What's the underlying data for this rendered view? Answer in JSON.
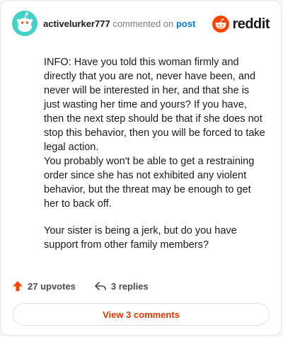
{
  "header": {
    "username": "activelurker777",
    "action_text": "commented on",
    "post_link": "post",
    "avatar_icon": "snoo-avatar-icon",
    "logo_word": "reddit"
  },
  "comment": {
    "paragraphs": [
      "INFO: Have you told this woman firmly and directly that you are not, never have been, and never will be interested in her, and that she is just wasting her time and yours? If you have, then the next step should be that if she does not stop this behavior, then you will be forced to take legal action.\nYou probably won't be able to get a restraining order since she has not exhibited any violent behavior, but the threat may be enough to get her to back off.",
      "Your sister is being a jerk, but do you have support from other family members?"
    ]
  },
  "footer": {
    "upvotes": "27 upvotes",
    "replies": "3 replies",
    "view_comments": "View 3 comments"
  },
  "colors": {
    "brand": "#ff4500",
    "link": "#0079d3",
    "avatar_bg": "#46d1c8"
  }
}
